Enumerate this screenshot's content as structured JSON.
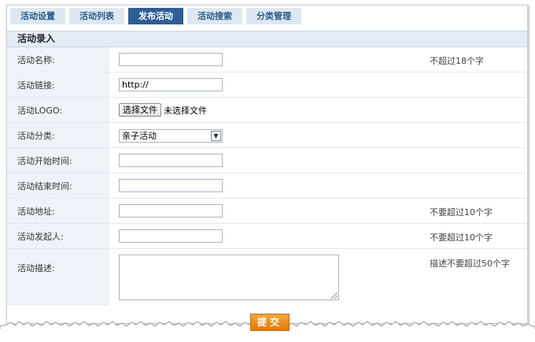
{
  "tabs": [
    {
      "label": "活动设置",
      "active": false
    },
    {
      "label": "活动列表",
      "active": false
    },
    {
      "label": "发布活动",
      "active": true
    },
    {
      "label": "活动搜索",
      "active": false
    },
    {
      "label": "分类管理",
      "active": false
    }
  ],
  "section_title": "活动录入",
  "fields": {
    "name": {
      "label": "活动名称:",
      "value": "",
      "tip": "不超过18个字"
    },
    "link": {
      "label": "活动链接:",
      "value": "http://"
    },
    "logo": {
      "label": "活动LOGO:",
      "button": "选择文件",
      "status": "未选择文件"
    },
    "category": {
      "label": "活动分类:",
      "selected": "亲子活动"
    },
    "start": {
      "label": "活动开始时间:",
      "value": ""
    },
    "end": {
      "label": "活动结束时间:",
      "value": ""
    },
    "address": {
      "label": "活动地址:",
      "value": "",
      "tip": "不要超过10个字"
    },
    "organizer": {
      "label": "活动发起人:",
      "value": "",
      "tip": "不要超过10个字"
    },
    "description": {
      "label": "活动描述:",
      "value": "",
      "tip": "描述不要超过50个字"
    }
  },
  "submit_label": "提交",
  "colors": {
    "tab_active": "#2e5e94",
    "tab": "#dfe8f2",
    "label_bg": "#eef3f9",
    "submit": "#f08c1e"
  }
}
